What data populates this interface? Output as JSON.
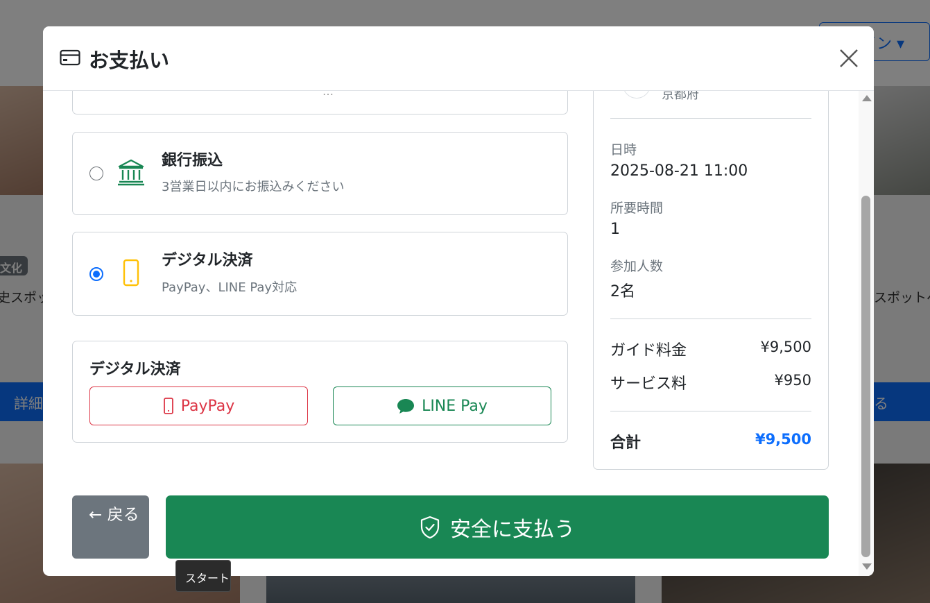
{
  "background": {
    "login_label": "イン ▾",
    "badge": "文化",
    "left_text": "史スポッ",
    "right_text": "スポットへ",
    "left_button": "詳細",
    "right_button": "る"
  },
  "modal": {
    "title": "お支払い",
    "top_stub_text": "…"
  },
  "payment_methods": {
    "bank": {
      "title": "銀行振込",
      "description": "3営業日以内にお振込みください"
    },
    "digital": {
      "title": "デジタル決済",
      "description": "PayPay、LINE Pay対応"
    }
  },
  "digital_panel": {
    "title": "デジタル決済",
    "paypay_label": "PayPay",
    "linepay_label": "LINE Pay"
  },
  "summary": {
    "cut_text": "京都府",
    "datetime_label": "日時",
    "datetime_value": "2025-08-21 11:00",
    "duration_label": "所要時間",
    "duration_value": "1",
    "people_label": "参加人数",
    "people_value": "2名",
    "guide_fee_label": "ガイド料金",
    "guide_fee_amount": "¥9,500",
    "service_fee_label": "サービス料",
    "service_fee_amount": "¥950",
    "total_label": "合計",
    "total_amount": "¥9,500"
  },
  "actions": {
    "back_arrow": "←",
    "back_label": "戻る",
    "submit_label": "安全に支払う"
  },
  "tooltip": "スタート",
  "colors": {
    "primary": "#0d6efd",
    "success": "#198754",
    "danger": "#dc3545",
    "secondary": "#6c757d",
    "warning": "#ffc107"
  }
}
